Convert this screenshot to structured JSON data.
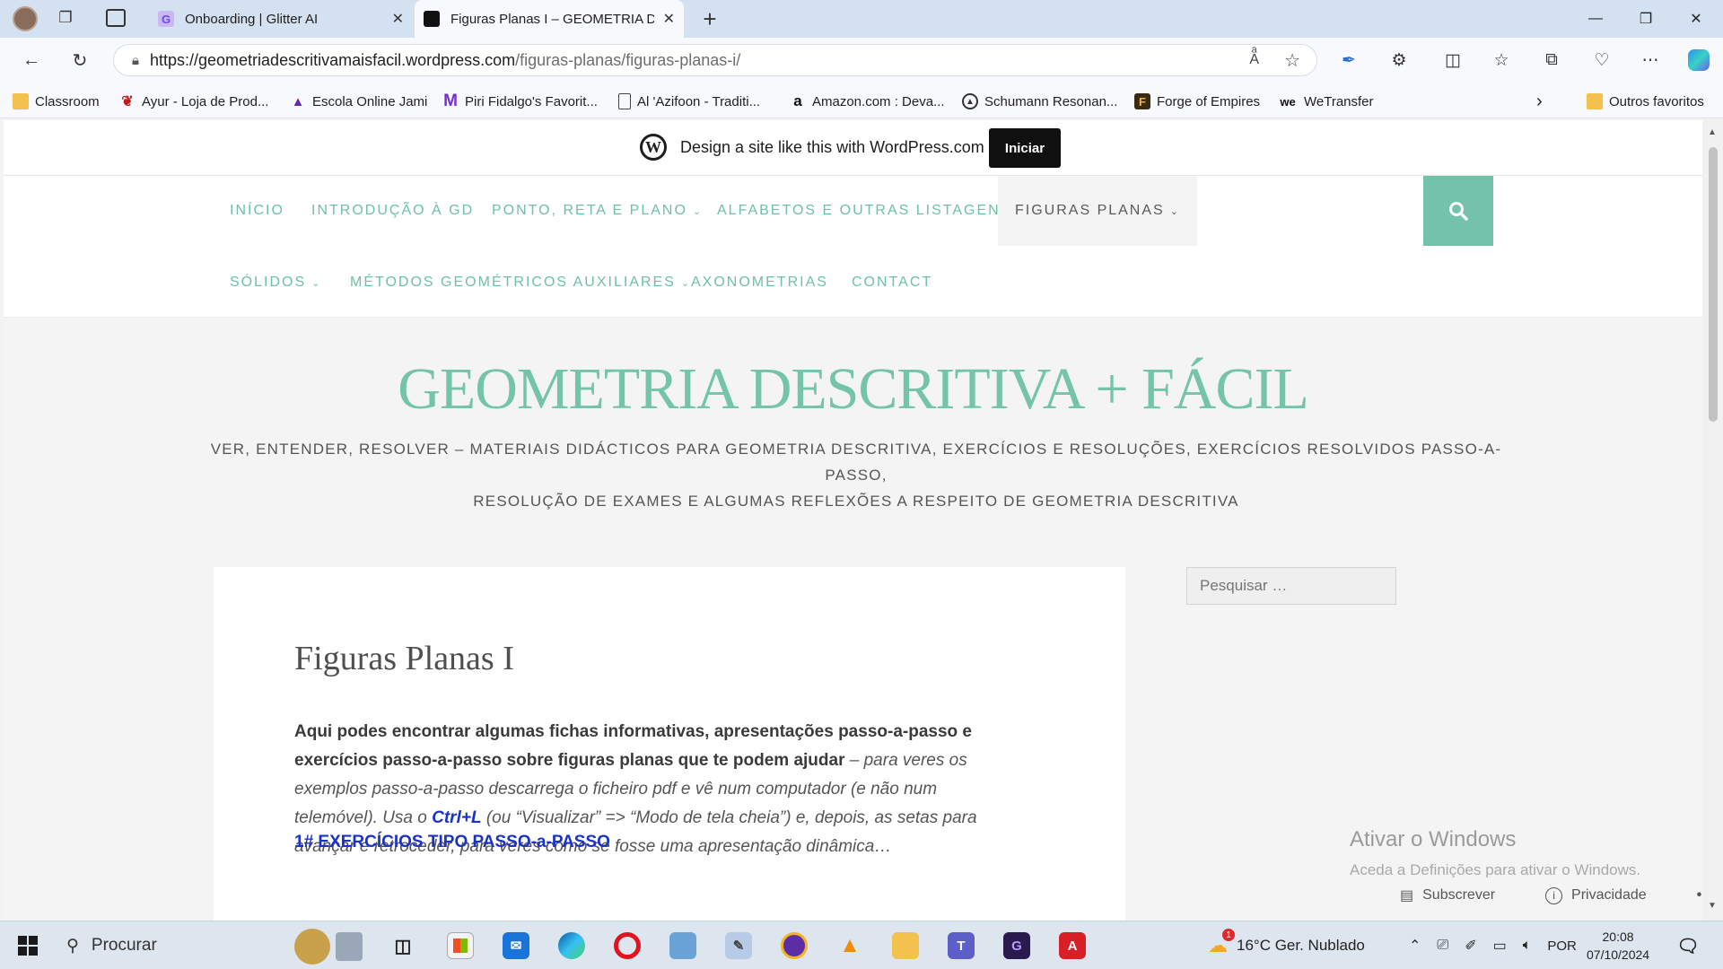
{
  "browser": {
    "tabs": [
      {
        "title": "Onboarding | Glitter AI",
        "active": false
      },
      {
        "title": "Figuras Planas I – GEOMETRIA DESCRITIVA + FÁCIL",
        "active": true
      }
    ],
    "url_host": "https://geometriadescritivamaisfacil.wordpress.com",
    "url_path": "/figuras-planas/figuras-planas-i/",
    "bookmarks": [
      {
        "label": "Classroom",
        "icon": "folder-icon"
      },
      {
        "label": "Ayur - Loja de Prod...",
        "icon": "leaf-icon"
      },
      {
        "label": "Escola Online Jami",
        "icon": "dome-icon"
      },
      {
        "label": "Piri Fidalgo's Favorit...",
        "icon": "m-logo-icon"
      },
      {
        "label": "Al 'Azifoon - Traditi...",
        "icon": "page-icon"
      },
      {
        "label": "Amazon.com : Deva...",
        "icon": "amazon-icon"
      },
      {
        "label": "Schumann Resonan...",
        "icon": "circle-logo-icon"
      },
      {
        "label": "Forge of Empires",
        "icon": "f-logo-icon"
      },
      {
        "label": "WeTransfer",
        "icon": "we-logo-icon"
      }
    ],
    "other_favorites": "Outros favoritos"
  },
  "wpbar": {
    "text": "Design a site like this with WordPress.com",
    "button": "Iniciar"
  },
  "menu": {
    "row1": [
      {
        "label": "INÍCIO",
        "dropdown": false
      },
      {
        "label": "INTRODUÇÃO À GD",
        "dropdown": false
      },
      {
        "label": "PONTO, RETA E PLANO",
        "dropdown": true
      },
      {
        "label": "ALFABETOS E OUTRAS LISTAGENS",
        "dropdown": false
      },
      {
        "label": "FIGURAS PLANAS",
        "dropdown": true,
        "current": true
      }
    ],
    "row2": [
      {
        "label": "SÓLIDOS",
        "dropdown": true
      },
      {
        "label": "MÉTODOS GEOMÉTRICOS AUXILIARES",
        "dropdown": true
      },
      {
        "label": "AXONOMETRIAS",
        "dropdown": false
      },
      {
        "label": "CONTACT",
        "dropdown": false
      }
    ]
  },
  "site": {
    "title": "GEOMETRIA DESCRITIVA + FÁCIL",
    "tagline_line1": "VER, ENTENDER, RESOLVER – MATERIAIS DIDÁCTICOS PARA GEOMETRIA DESCRITIVA, EXERCÍCIOS E RESOLUÇÕES, EXERCÍCIOS RESOLVIDOS PASSO-A-PASSO,",
    "tagline_line2": "RESOLUÇÃO DE EXAMES E ALGUMAS REFLEXÕES A RESPEITO DE GEOMETRIA DESCRITIVA"
  },
  "post": {
    "title": "Figuras Planas I",
    "bold_intro": "Aqui podes encontrar algumas fichas informativas, apresentações passo-a-passo e exercícios passo-a-passo sobre figuras planas que te podem ajudar",
    "italic_part1": " – para veres os exemplos passo-a-passo descarrega o ficheiro pdf e vê num computador (e não num telemóvel). Usa o ",
    "shortcut": "Ctrl+L",
    "italic_part2": " (ou “Visualizar” => “Modo de tela cheia”) e, depois, as setas para avançar e retroceder, para veres como se fosse uma apresentação dinâmica…",
    "section_link": "1# EXERCÍCIOS TIPO PASSO-a-PASSO"
  },
  "sidebar": {
    "search_placeholder": "Pesquisar …"
  },
  "overlay": {
    "activate_title": "Ativar o Windows",
    "activate_sub": "Aceda a Definições para ativar o Windows.",
    "subscribe": "Subscrever",
    "privacy": "Privacidade",
    "more": "•••"
  },
  "taskbar": {
    "search_label": "Procurar",
    "weather_badge": "1",
    "weather": "16°C  Ger. Nublado",
    "language": "POR",
    "time": "20:08",
    "date": "07/10/2024"
  }
}
